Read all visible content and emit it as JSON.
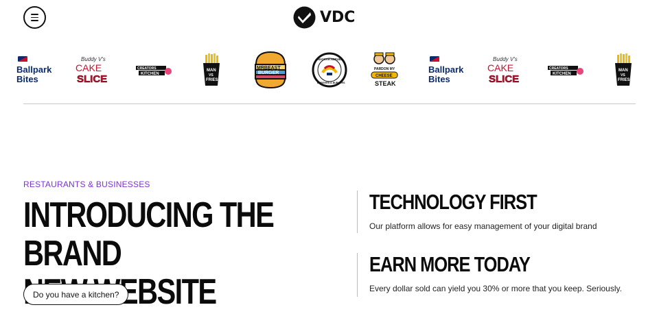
{
  "header": {
    "menu_icon": "hamburger-menu-icon",
    "logo_text": "VDC",
    "logo_icon": "vdc-check-mark-icon"
  },
  "brands": [
    {
      "name": "ballpark-bites",
      "line1": "Ballpark",
      "line2": "Bites"
    },
    {
      "name": "buddy-v-cake-slice",
      "script": "Buddy V's",
      "line1": "CAKE",
      "line2": "SLICE"
    },
    {
      "name": "creators-kitchen",
      "line1": "CREATORS",
      "line2": "KITCHEN"
    },
    {
      "name": "man-vs-fries",
      "line1": "MAN",
      "line2": "VS",
      "line3": "FRIES"
    },
    {
      "name": "mrbeast-burger",
      "line1": "MRBEAST",
      "line2": "BURGER"
    },
    {
      "name": "nascar-refuel",
      "line1": "NASCAR REFUEL",
      "line2": "BURGERS & BURGERS"
    },
    {
      "name": "pardon-my-cheesesteak",
      "line1": "PARDON MY",
      "line2": "CHEESE",
      "line3": "STEAK"
    },
    {
      "name": "ballpark-bites",
      "line1": "Ballpark",
      "line2": "Bites"
    },
    {
      "name": "buddy-v-cake-slice",
      "script": "Buddy V's",
      "line1": "CAKE",
      "line2": "SLICE"
    },
    {
      "name": "creators-kitchen",
      "line1": "CREATORS",
      "line2": "KITCHEN"
    },
    {
      "name": "man-vs-fries",
      "line1": "MAN",
      "line2": "VS",
      "line3": "FRIES"
    }
  ],
  "section": {
    "eyebrow": "RESTAURANTS & BUSINESSES",
    "headline_line1": "INTRODUCING THE BRAND",
    "headline_line2": "NEW WEBSITE",
    "cta_label": "Do you have a kitchen?"
  },
  "features": [
    {
      "title": "TECHNOLOGY FIRST",
      "text": "Our platform allows for easy management of your digital brand"
    },
    {
      "title": "EARN MORE TODAY",
      "text": "Every dollar sold can yield you 30% or more that you keep. Seriously."
    }
  ],
  "colors": {
    "eyebrow": "#7b2fd6",
    "text": "#0b0b0b",
    "divider": "#c8c8c8"
  }
}
